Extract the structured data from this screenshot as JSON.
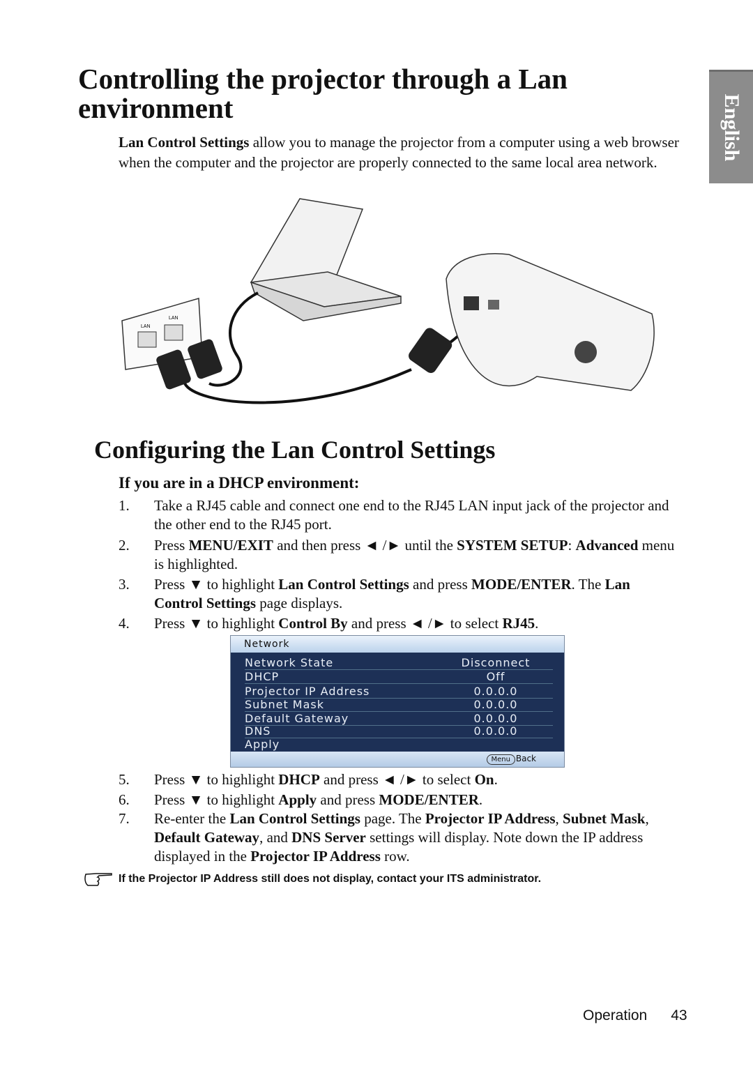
{
  "side_tab": "English",
  "title": "Controlling the projector through a Lan environment",
  "intro": [
    {
      "t": "Lan Control Settings",
      "b": true
    },
    {
      "t": " allow you to manage the projector from a computer using a web browser when the computer and the projector are properly connected to the same local area network.",
      "b": false
    }
  ],
  "illustration": {
    "wall_port_labels": [
      "LAN",
      "LAN"
    ]
  },
  "section_title": "Configuring the Lan Control Settings",
  "subsection_title": "If you are in a DHCP environment:",
  "steps_a": [
    {
      "num": "1.",
      "segs": [
        {
          "t": "Take a RJ45 cable and connect one end to the RJ45 LAN input jack of the projector and the other end to the RJ45 port.",
          "b": false
        }
      ]
    },
    {
      "num": "2.",
      "segs": [
        {
          "t": "Press ",
          "b": false
        },
        {
          "t": "MENU/EXIT",
          "b": true
        },
        {
          "t": " and then press ◄ /► until the ",
          "b": false
        },
        {
          "t": "SYSTEM SETUP",
          "b": true
        },
        {
          "t": ": ",
          "b": false
        },
        {
          "t": "Advanced",
          "b": true
        },
        {
          "t": " menu is highlighted.",
          "b": false
        }
      ]
    },
    {
      "num": "3.",
      "segs": [
        {
          "t": "Press ▼ to highlight ",
          "b": false
        },
        {
          "t": "Lan Control Settings",
          "b": true
        },
        {
          "t": " and press ",
          "b": false
        },
        {
          "t": "MODE/ENTER",
          "b": true
        },
        {
          "t": ". The ",
          "b": false
        },
        {
          "t": "Lan Control Settings",
          "b": true
        },
        {
          "t": " page displays.",
          "b": false
        }
      ]
    },
    {
      "num": "4.",
      "segs": [
        {
          "t": "Press ▼ to highlight ",
          "b": false
        },
        {
          "t": "Control By",
          "b": true
        },
        {
          "t": " and press ◄ /► to select ",
          "b": false
        },
        {
          "t": "RJ45",
          "b": true
        },
        {
          "t": ".",
          "b": false
        }
      ]
    }
  ],
  "menu": {
    "title": "Network",
    "rows": [
      {
        "label": "Network State",
        "value": "Disconnect"
      },
      {
        "label": "DHCP",
        "value": "Off"
      },
      {
        "label": "Projector IP Address",
        "value": "0.0.0.0"
      },
      {
        "label": "Subnet Mask",
        "value": "0.0.0.0"
      },
      {
        "label": "Default Gateway",
        "value": "0.0.0.0"
      },
      {
        "label": "DNS",
        "value": "0.0.0.0"
      },
      {
        "label": "Apply",
        "value": ""
      }
    ],
    "menu_key": "Menu",
    "back": "Back",
    "colors": {
      "body": "#1d3056",
      "header": "#c8dcf0"
    }
  },
  "steps_b": [
    {
      "num": "5.",
      "segs": [
        {
          "t": "Press ▼ to highlight ",
          "b": false
        },
        {
          "t": "DHCP",
          "b": true
        },
        {
          "t": " and press ◄ /► to select ",
          "b": false
        },
        {
          "t": "On",
          "b": true
        },
        {
          "t": ".",
          "b": false
        }
      ]
    },
    {
      "num": "6.",
      "segs": [
        {
          "t": "Press ▼ to highlight ",
          "b": false
        },
        {
          "t": "Apply",
          "b": true
        },
        {
          "t": " and press ",
          "b": false
        },
        {
          "t": "MODE/ENTER",
          "b": true
        },
        {
          "t": ".",
          "b": false
        }
      ]
    },
    {
      "num": "7.",
      "segs": [
        {
          "t": "Re-enter the ",
          "b": false
        },
        {
          "t": "Lan Control Settings",
          "b": true
        },
        {
          "t": " page. The ",
          "b": false
        },
        {
          "t": "Projector IP Address",
          "b": true
        },
        {
          "t": ", ",
          "b": false
        },
        {
          "t": "Subnet Mask",
          "b": true
        },
        {
          "t": ", ",
          "b": false
        },
        {
          "t": "Default Gateway",
          "b": true
        },
        {
          "t": ", and ",
          "b": false
        },
        {
          "t": "DNS Server",
          "b": true
        },
        {
          "t": " settings will display. Note down the IP address displayed in the ",
          "b": false
        },
        {
          "t": "Projector IP Address",
          "b": true
        },
        {
          "t": " row.",
          "b": false
        }
      ]
    }
  ],
  "note": {
    "icon": "pointing-hand-icon",
    "text": "If the Projector IP Address still does not display, contact your ITS administrator."
  },
  "footer": {
    "section": "Operation",
    "page": "43"
  }
}
